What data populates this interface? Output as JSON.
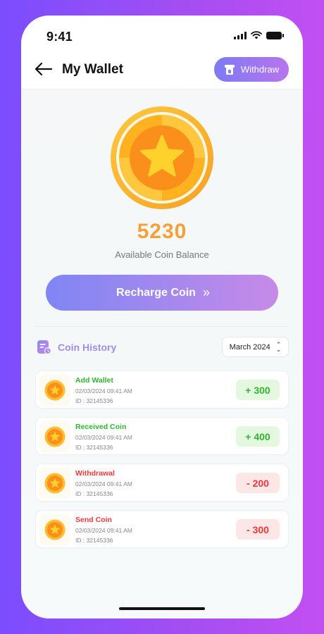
{
  "status_bar": {
    "time": "9:41"
  },
  "header": {
    "title": "My Wallet",
    "withdraw_label": "Withdraw"
  },
  "balance": {
    "amount": "5230",
    "label": "Available Coin Balance"
  },
  "recharge": {
    "label": "Recharge Coin",
    "chevron": "»"
  },
  "history": {
    "title": "Coin History",
    "month": "March 2024"
  },
  "transactions": [
    {
      "title": "Add Wallet",
      "date": "02/03/2024  09:41 AM",
      "id": "ID : 32145336",
      "amount": "+ 300",
      "type": "credit"
    },
    {
      "title": "Received Coin",
      "date": "02/03/2024  09:41 AM",
      "id": "ID : 32145336",
      "amount": "+ 400",
      "type": "credit"
    },
    {
      "title": "Withdrawal",
      "date": "02/03/2024  09:41 AM",
      "id": "ID : 32145336",
      "amount": "- 200",
      "type": "debit"
    },
    {
      "title": "Send Coin",
      "date": "02/03/2024  09:41 AM",
      "id": "ID : 32145336",
      "amount": "- 300",
      "type": "debit"
    }
  ],
  "colors": {
    "credit_text": "#2fb62f",
    "credit_bg": "#e3f8df",
    "debit_text": "#f0363a",
    "debit_bg": "#fde6e6",
    "accent_orange": "#f6a03c",
    "accent_purple": "#a58ae6"
  },
  "icons": {
    "back": "arrow-left-icon",
    "withdraw": "atm-card-icon",
    "coin": "star-coin-icon",
    "history": "history-document-icon",
    "month_select": "up-down-chevron-icon",
    "signal": "cellular-signal-icon",
    "wifi": "wifi-icon",
    "battery": "battery-icon"
  }
}
